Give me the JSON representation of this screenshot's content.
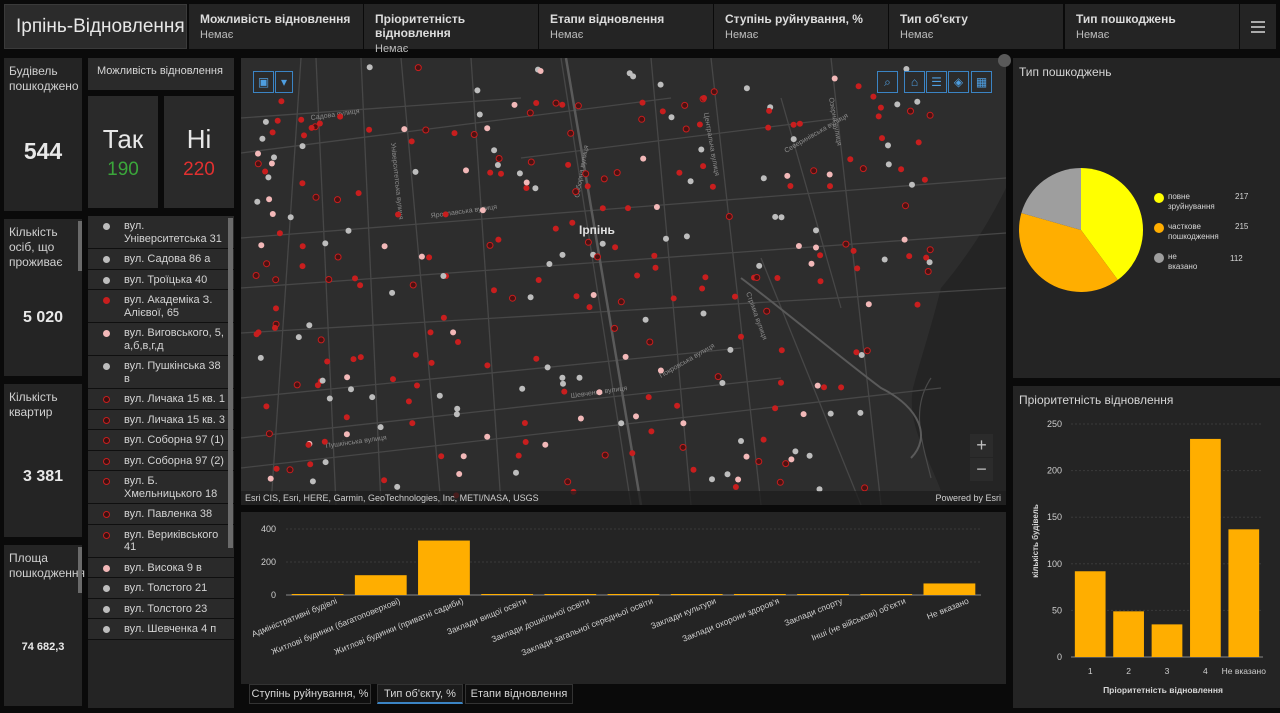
{
  "header": {
    "title": "Ірпінь-Відновлення",
    "filters": [
      {
        "label": "Можливість відновлення",
        "value": "Немає"
      },
      {
        "label": "Пріоритетність відновлення",
        "value": "Немає"
      },
      {
        "label": "Етапи відновлення",
        "value": "Немає"
      },
      {
        "label": "Ступінь руйнування, %",
        "value": "Немає"
      },
      {
        "label": "Тип об'єкту",
        "value": "Немає"
      },
      {
        "label": "Тип пошкоджень",
        "value": "Немає"
      }
    ]
  },
  "stats": [
    {
      "label": "Будівель пошкоджено",
      "value": "544"
    },
    {
      "label": "Кількість осіб, що проживає",
      "value": "5 020"
    },
    {
      "label": "Кількість квартир",
      "value": "3 381"
    },
    {
      "label": "Площа пошкодження",
      "value": "74 682,3"
    }
  ],
  "restore": {
    "title": "Можливість відновлення",
    "yes_label": "Так",
    "yes_count": "190",
    "no_label": "Ні",
    "no_count": "220",
    "yes_color": "#3aa63a",
    "no_color": "#e23030"
  },
  "list": [
    {
      "text": "вул. Університетська 31",
      "kind": "grey"
    },
    {
      "text": "вул. Садова 86 а",
      "kind": "grey"
    },
    {
      "text": "вул. Троїцька 40",
      "kind": "grey"
    },
    {
      "text": "вул. Академіка З. Алієвої, 65",
      "kind": "red"
    },
    {
      "text": "вул. Виговського, 5, а,б,в,г,д",
      "kind": "pink"
    },
    {
      "text": "вул. Пушкінська 38 в",
      "kind": "grey"
    },
    {
      "text": "вул. Личака 15 кв. 1",
      "kind": "ring"
    },
    {
      "text": "вул. Личака 15 кв. 3",
      "kind": "ring"
    },
    {
      "text": "вул. Соборна 97 (1)",
      "kind": "ring"
    },
    {
      "text": "вул. Соборна 97 (2)",
      "kind": "ring"
    },
    {
      "text": "вул. Б. Хмельницького 18",
      "kind": "ring"
    },
    {
      "text": "вул. Павленка 38",
      "kind": "ring"
    },
    {
      "text": "вул. Вериківського 41",
      "kind": "ring"
    },
    {
      "text": "вул. Висока 9 в",
      "kind": "pink"
    },
    {
      "text": "вул. Толстого 21",
      "kind": "grey"
    },
    {
      "text": "вул. Толстого 23",
      "kind": "grey"
    },
    {
      "text": "вул. Шевченка 4 п",
      "kind": "grey"
    }
  ],
  "map": {
    "city_label": "Ірпінь",
    "attribution": "Esri CIS, Esri, HERE, Garmin, GeoTechnologies, Inc, METI/NASA, USGS",
    "powered": "Powered by Esri",
    "streets": [
      "Садова вулиця",
      "Ярославська вулиця",
      "Соборна вулиця",
      "Університетська вулиця",
      "Пушкінська вулиця",
      "Садова вулиця",
      "Шевченка вулиця",
      "Покровська вулиця",
      "Северинівська вулиця",
      "Центральна вулиця",
      "Озерна вулиця",
      "Стрімка вулиця"
    ],
    "zoom_in": "+",
    "zoom_out": "−",
    "colors": {
      "red": "#c81e1e",
      "grey": "#bdbdbd",
      "pink": "#f2b8b8",
      "ring": "#8a1010"
    }
  },
  "chart_data": [
    {
      "type": "bar",
      "panel": "bottom",
      "categories": [
        "Адміністративні будівлі",
        "Житлові будинки (багатоповерхові)",
        "Житлові будинки (приватні садиби)",
        "Заклади вищої освіти",
        "Заклади дошкільної освіти",
        "Заклади загальної середньої освіти",
        "Заклади культури",
        "Заклади охорони здоров'я",
        "Заклади спорту",
        "Інші (не військові) об'єкти",
        "Не вказано"
      ],
      "values": [
        2,
        120,
        330,
        1,
        5,
        3,
        1,
        1,
        1,
        2,
        70
      ],
      "ylim": [
        0,
        400
      ],
      "yticks": [
        "0",
        "200",
        "400"
      ],
      "color": "#ffae00"
    },
    {
      "type": "pie",
      "panel": "right-top",
      "title": "Тип пошкоджень",
      "series": [
        {
          "name": "повне зруйнування",
          "value": 217,
          "color": "#ffff00"
        },
        {
          "name": "часткове пошкодження",
          "value": 215,
          "color": "#ffae00"
        },
        {
          "name": "не вказано",
          "value": 112,
          "color": "#9e9e9e"
        }
      ],
      "legend": "right"
    },
    {
      "type": "bar",
      "panel": "right-bottom",
      "title": "Пріоритетність відновлення",
      "categories": [
        "1",
        "2",
        "3",
        "4",
        "Не вказано"
      ],
      "values": [
        92,
        49,
        35,
        234,
        137
      ],
      "ylim": [
        0,
        250
      ],
      "yticks": [
        "0",
        "50",
        "100",
        "150",
        "200",
        "250"
      ],
      "xlabel": "Пріоритетність відновлення",
      "ylabel": "кількість будівель",
      "color": "#ffae00"
    }
  ],
  "tabs": [
    "Ступінь руйнування, %",
    "Тип об'єкту, %",
    "Етапи відновлення"
  ]
}
